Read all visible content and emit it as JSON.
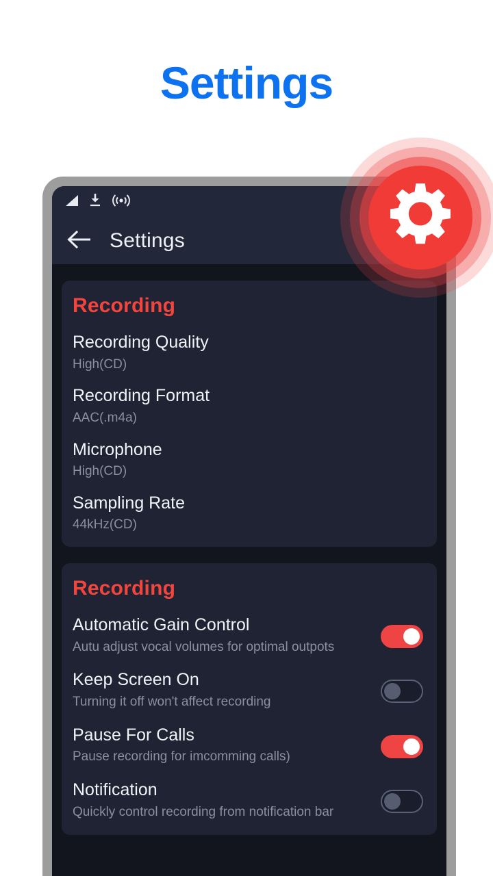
{
  "page": {
    "title": "Settings",
    "title_color": "#0d72f0",
    "background": "#ffffff"
  },
  "phone": {
    "frame_color": "#9d9d9d",
    "screen_background": "#12151e"
  },
  "statusbar": {
    "left_icons": [
      "signal-icon",
      "download-icon",
      "cast-icon"
    ],
    "right_icons": [
      "wifi-icon",
      "battery-icon"
    ],
    "background": "#222739"
  },
  "appbar": {
    "back_icon": "back-arrow-icon",
    "title": "Settings",
    "background": "#222739"
  },
  "badge": {
    "icon": "gear-icon",
    "color": "#f03b36",
    "halo_color": "#ef4444"
  },
  "sections": [
    {
      "header": "Recording",
      "header_color": "#f2453d",
      "type": "values",
      "rows": [
        {
          "title": "Recording Quality",
          "value": "High(CD)"
        },
        {
          "title": "Recording Format",
          "value": "AAC(.m4a)"
        },
        {
          "title": "Microphone",
          "value": "High(CD)"
        },
        {
          "title": "Sampling Rate",
          "value": "44kHz(CD)"
        }
      ]
    },
    {
      "header": "Recording",
      "header_color": "#f2453d",
      "type": "toggles",
      "rows": [
        {
          "title": "Automatic Gain Control",
          "value": "Autu adjust vocal volumes for optimal outpots",
          "state": "on"
        },
        {
          "title": "Keep Screen On",
          "value": "Turning it off won't affect recording",
          "state": "off"
        },
        {
          "title": "Pause For Calls",
          "value": "Pause recording for imcomming calls)",
          "state": "on"
        },
        {
          "title": "Notification",
          "value": "Quickly control recording from notification bar",
          "state": "off"
        }
      ]
    }
  ]
}
